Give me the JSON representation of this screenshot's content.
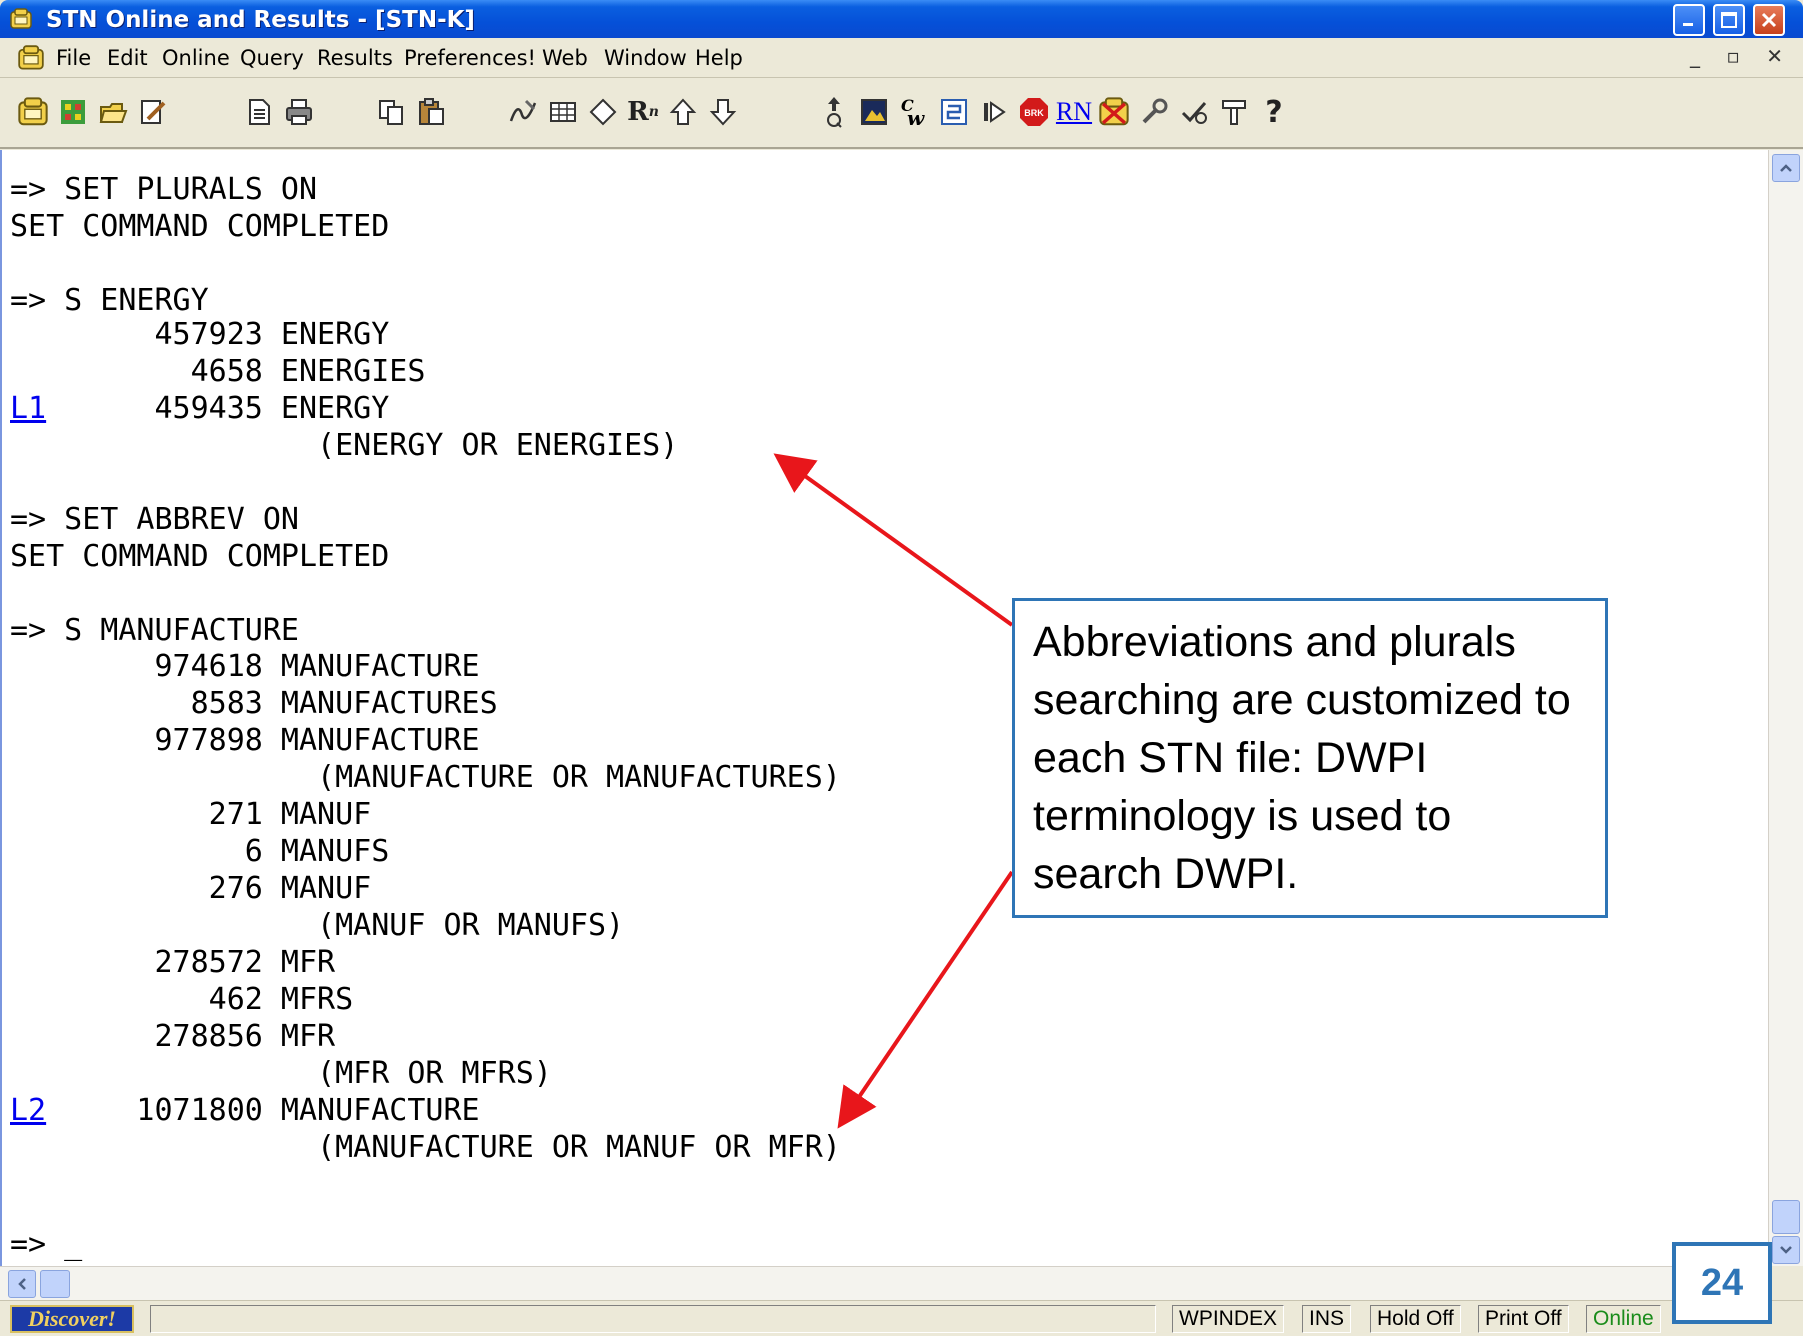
{
  "window": {
    "title": "STN Online and Results - [STN-K]"
  },
  "menu": {
    "items": [
      "File",
      "Edit",
      "Online",
      "Query",
      "Results",
      "Preferences!",
      "Web",
      "Window",
      "Help"
    ],
    "mdi_controls": "_ ▫ ✕"
  },
  "toolbar": {
    "icons": [
      "stn-logo-icon",
      "connect-icon",
      "open-icon",
      "edit-icon",
      "document-icon",
      "print-icon",
      "copy-icon",
      "paste-icon",
      "signature-icon",
      "table-icon",
      "diamond-icon",
      "r-icon",
      "up-arrow-icon",
      "down-arrow-icon",
      "query-icon",
      "image-icon",
      "formula-icon",
      "structure-icon",
      "play-icon",
      "break-icon",
      "rn-icon",
      "stn-crossed-icon",
      "tools-icon",
      "check-icon",
      "hammer-icon",
      "help-icon"
    ],
    "labels": {
      "r": "R",
      "rn": "RN",
      "help": "?",
      "brk": "BRK"
    }
  },
  "terminal": {
    "lines": [
      "=> SET PLURALS ON",
      "SET COMMAND COMPLETED",
      "",
      "=> S ENERGY",
      "        457923 ENERGY",
      "          4658 ENERGIES",
      "        459435 ENERGY",
      "                 (ENERGY OR ENERGIES)",
      "",
      "=> SET ABBREV ON",
      "SET COMMAND COMPLETED",
      "",
      "=> S MANUFACTURE",
      "        974618 MANUFACTURE",
      "          8583 MANUFACTURES",
      "        977898 MANUFACTURE",
      "                 (MANUFACTURE OR MANUFACTURES)",
      "           271 MANUF",
      "             6 MANUFS",
      "           276 MANUF",
      "                 (MANUF OR MANUFS)",
      "        278572 MFR",
      "           462 MFRS",
      "        278856 MFR",
      "                 (MFR OR MFRS)",
      "       1071800 MANUFACTURE",
      "                 (MANUFACTURE OR MANUF OR MFR)",
      "",
      "=> _"
    ],
    "links": [
      {
        "label": "L1",
        "line": 6
      },
      {
        "label": "L2",
        "line": 25
      }
    ]
  },
  "statusbar": {
    "discover": "Discover!",
    "cells": [
      "WPINDEX",
      "INS",
      "Hold Off",
      "Print Off",
      "Online"
    ]
  },
  "annotation": {
    "callout": "Abbreviations and plurals searching are customized to each STN file: DWPI terminology is used to search DWPI.",
    "page_number": "24"
  },
  "colors": {
    "titlebar": "#0a5fe0",
    "callout_border": "#2e75b6",
    "arrow": "#e8161b",
    "link": "#0000ee"
  }
}
